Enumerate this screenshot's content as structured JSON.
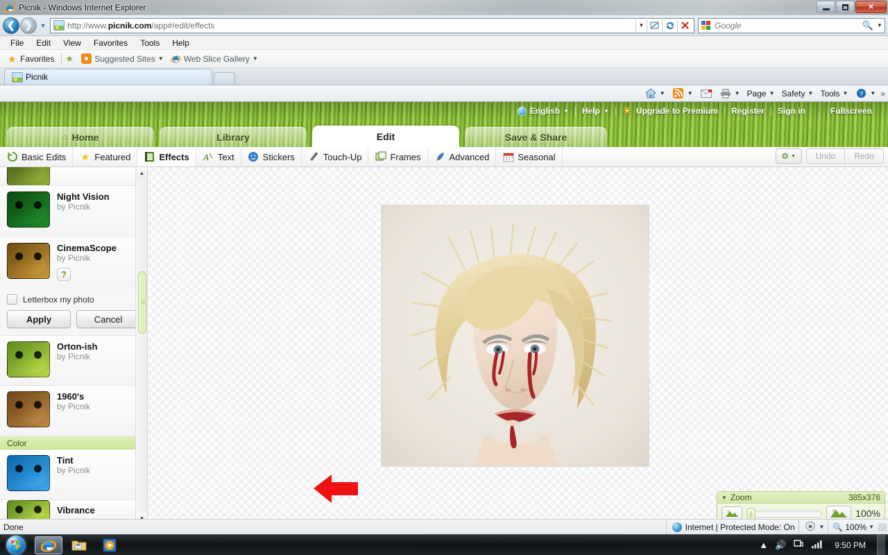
{
  "window": {
    "title": "Picnik - Windows Internet Explorer",
    "app_icon": "ie-logo-icon",
    "minimize_label": "Minimize",
    "maximize_label": "Maximize",
    "close_label": "Close"
  },
  "address_bar": {
    "url_protocol": "http://www.",
    "url_domain": "picnik.com",
    "url_path": "/app#/edit/effects",
    "full_url": "http://www.picnik.com/app#/edit/effects",
    "back_label": "Back",
    "forward_label": "Forward",
    "compat_label": "Compatibility View",
    "refresh_label": "Refresh",
    "stop_label": "Stop",
    "search_placeholder": "Google",
    "search_value": ""
  },
  "menu": {
    "items": [
      "File",
      "Edit",
      "View",
      "Favorites",
      "Tools",
      "Help"
    ]
  },
  "favorites_bar": {
    "favorites_label": "Favorites",
    "suggested_sites_label": "Suggested Sites",
    "web_slice_label": "Web Slice Gallery"
  },
  "tabs": {
    "items": [
      {
        "label": "Picnik"
      }
    ],
    "new_tab_label": ""
  },
  "command_bar": {
    "items": [
      {
        "label": "",
        "icon": "home-icon",
        "caret": true
      },
      {
        "label": "",
        "icon": "feeds-icon",
        "caret": true
      },
      {
        "label": "",
        "icon": "read-mail-icon",
        "caret": false
      },
      {
        "label": "",
        "icon": "print-icon",
        "caret": true
      },
      {
        "label": "Page",
        "icon": "",
        "caret": true
      },
      {
        "label": "Safety",
        "icon": "",
        "caret": true
      },
      {
        "label": "Tools",
        "icon": "",
        "caret": true
      },
      {
        "label": "",
        "icon": "help-icon",
        "caret": true
      }
    ],
    "overflow_label": "»"
  },
  "picnik": {
    "topnav": [
      {
        "label": "English",
        "icon": "globe-icon",
        "caret": true
      },
      {
        "label": "Help",
        "icon": "",
        "caret": true
      },
      {
        "label": "Upgrade to Premium",
        "icon": "sun-icon",
        "caret": false
      },
      {
        "label": "Register",
        "icon": "",
        "caret": false
      },
      {
        "label": "Sign in",
        "icon": "",
        "caret": false
      },
      {
        "label": "Fullscreen",
        "icon": "",
        "caret": false
      }
    ],
    "main_tabs": [
      {
        "label": "Home",
        "icon": "home-icon",
        "active": false
      },
      {
        "label": "Library",
        "icon": "",
        "active": false
      },
      {
        "label": "Edit",
        "icon": "",
        "active": true
      },
      {
        "label": "Save & Share",
        "icon": "",
        "active": false
      }
    ],
    "sub_tabs": [
      {
        "label": "Basic Edits",
        "icon": "refresh-circle-icon",
        "active": false
      },
      {
        "label": "Featured",
        "icon": "star-icon",
        "active": false
      },
      {
        "label": "Effects",
        "icon": "effects-book-icon",
        "active": true
      },
      {
        "label": "Text",
        "icon": "text-icon",
        "active": false
      },
      {
        "label": "Stickers",
        "icon": "smiley-icon",
        "active": false
      },
      {
        "label": "Touch-Up",
        "icon": "lipstick-icon",
        "active": false
      },
      {
        "label": "Frames",
        "icon": "frames-icon",
        "active": false
      },
      {
        "label": "Advanced",
        "icon": "rocket-icon",
        "active": false
      },
      {
        "label": "Seasonal",
        "icon": "calendar-icon",
        "active": false
      }
    ],
    "toolbar_right": {
      "gear_label": "",
      "undo_label": "Undo",
      "redo_label": "Redo"
    },
    "effects_list": [
      {
        "name": "",
        "by": "",
        "partial": true,
        "thumb": "#6f7f2a"
      },
      {
        "name": "Night Vision",
        "by": "by Picnik",
        "thumb": "#0f6b18"
      },
      {
        "name": "CinemaScope",
        "by": "by Picnik",
        "thumb": "#7d5a18",
        "help_badge": "?"
      },
      {
        "name": "Orton-ish",
        "by": "by Picnik",
        "thumb": "#7a8f22"
      },
      {
        "name": "1960's",
        "by": "by Picnik",
        "thumb": "#7b4a1c"
      },
      {
        "name": "Tint",
        "by": "by Picnik",
        "thumb": "#1279c4"
      },
      {
        "name": "Vibrance",
        "by": "",
        "thumb": "#6d7a26"
      }
    ],
    "category_header": "Color",
    "options": {
      "letterbox_label": "Letterbox my photo",
      "letterbox_checked": false,
      "apply_label": "Apply",
      "cancel_label": "Cancel"
    },
    "highlight_color": "#ee1111",
    "zoom_panel": {
      "title": "Zoom",
      "dimensions": "385x376",
      "percent": "100%",
      "slider_value": 0
    }
  },
  "status_bar": {
    "status_text": "Done",
    "zone_text": "Internet | Protected Mode: On",
    "zoom_text": "100%"
  },
  "taskbar": {
    "start_label": "Start",
    "tasks": [
      {
        "name": "internet-explorer",
        "active": true
      },
      {
        "name": "windows-explorer",
        "active": false
      },
      {
        "name": "media-player",
        "active": false
      }
    ],
    "clock": "9:50 PM"
  }
}
